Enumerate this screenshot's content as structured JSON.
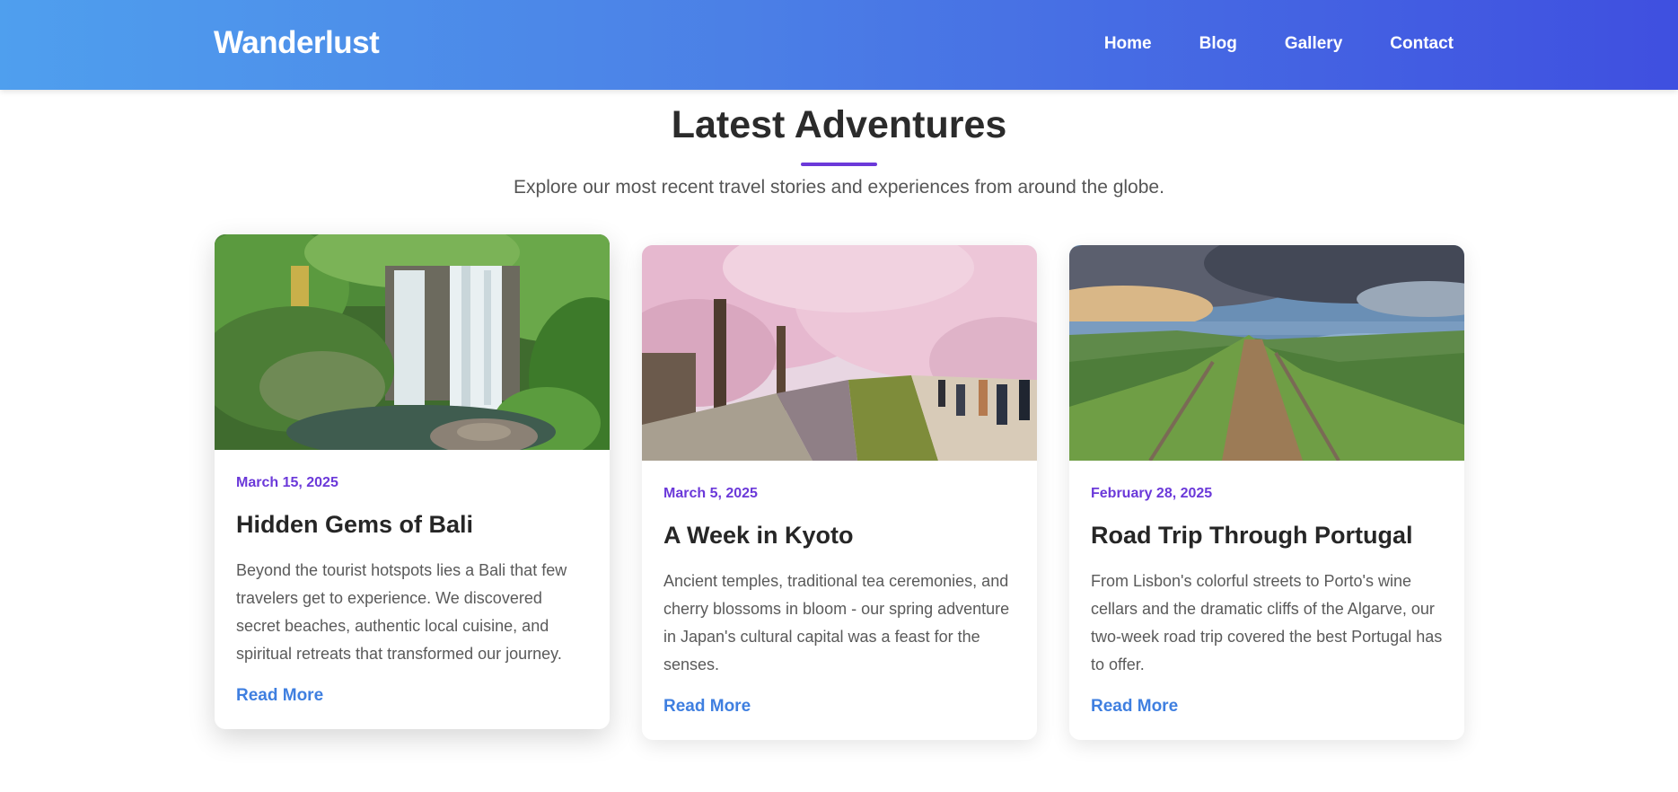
{
  "header": {
    "logo": "Wanderlust",
    "nav": [
      {
        "label": "Home"
      },
      {
        "label": "Blog"
      },
      {
        "label": "Gallery"
      },
      {
        "label": "Contact"
      }
    ]
  },
  "intro": {
    "title": "Latest Adventures",
    "subtitle": "Explore our most recent travel stories and experiences from around the globe."
  },
  "posts": [
    {
      "date": "March 15, 2025",
      "title": "Hidden Gems of Bali",
      "excerpt": "Beyond the tourist hotspots lies a Bali that few travelers get to experience. We discovered secret beaches, authentic local cuisine, and spiritual retreats that transformed our journey.",
      "read_more": "Read More",
      "image": "waterfall-jungle-photo"
    },
    {
      "date": "March 5, 2025",
      "title": "A Week in Kyoto",
      "excerpt": "Ancient temples, traditional tea ceremonies, and cherry blossoms in bloom - our spring adventure in Japan's cultural capital was a feast for the senses.",
      "read_more": "Read More",
      "image": "cherry-blossom-canal-photo"
    },
    {
      "date": "February 28, 2025",
      "title": "Road Trip Through Portugal",
      "excerpt": "From Lisbon's colorful streets to Porto's wine cellars and the dramatic cliffs of the Algarve, our two-week road trip covered the best Portugal has to offer.",
      "read_more": "Read More",
      "image": "mountain-ridge-trail-photo"
    }
  ],
  "colors": {
    "header_gradient_start": "#4f9fee",
    "header_gradient_end": "#3f4fe0",
    "accent_purple": "#6b39d9",
    "link_blue": "#3f7fe0"
  }
}
